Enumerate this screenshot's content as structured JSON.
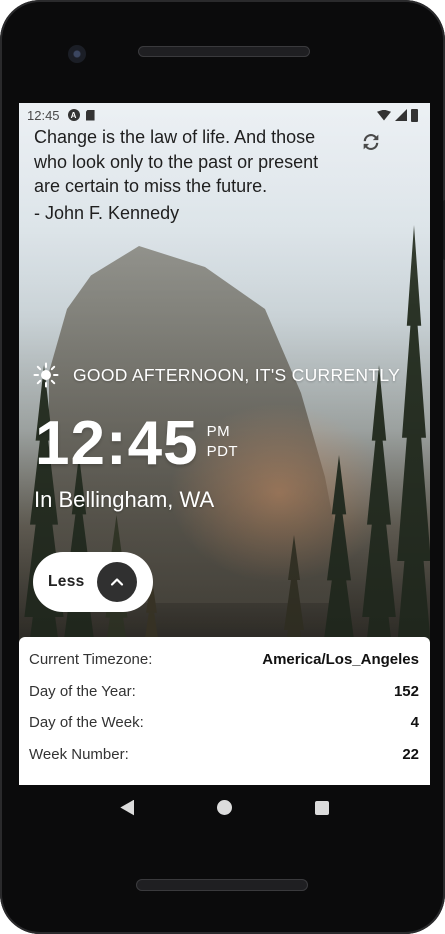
{
  "status_bar": {
    "time": "12:45",
    "icons": [
      "automation-icon",
      "sd-card-icon",
      "wifi-icon",
      "signal-icon",
      "battery-icon"
    ]
  },
  "quote": {
    "text": "Change is the law of life. And those who look only to the past or present are certain to miss the future.",
    "author": "- John F. Kennedy"
  },
  "greeting": {
    "icon": "sun-icon",
    "text": "GOOD AFTERNOON, IT'S CURRENTLY"
  },
  "clock": {
    "time": "12:45",
    "period": "PM",
    "timezone_abbr": "PDT"
  },
  "location": "In Bellingham, WA",
  "toggle_button": {
    "label": "Less",
    "icon": "chevron-up-icon"
  },
  "details": [
    {
      "label": "Current Timezone:",
      "value": "America/Los_Angeles"
    },
    {
      "label": "Day of the Year:",
      "value": "152"
    },
    {
      "label": "Day of the Week:",
      "value": "4"
    },
    {
      "label": "Week Number:",
      "value": "22"
    }
  ],
  "navigation": {
    "icons": [
      "back-icon",
      "home-icon",
      "recents-icon"
    ]
  },
  "colors": {
    "text_light": "#ffffff",
    "quote_text": "#1f1f1f",
    "panel_bg": "#ffffff",
    "button_circle": "#303030"
  }
}
